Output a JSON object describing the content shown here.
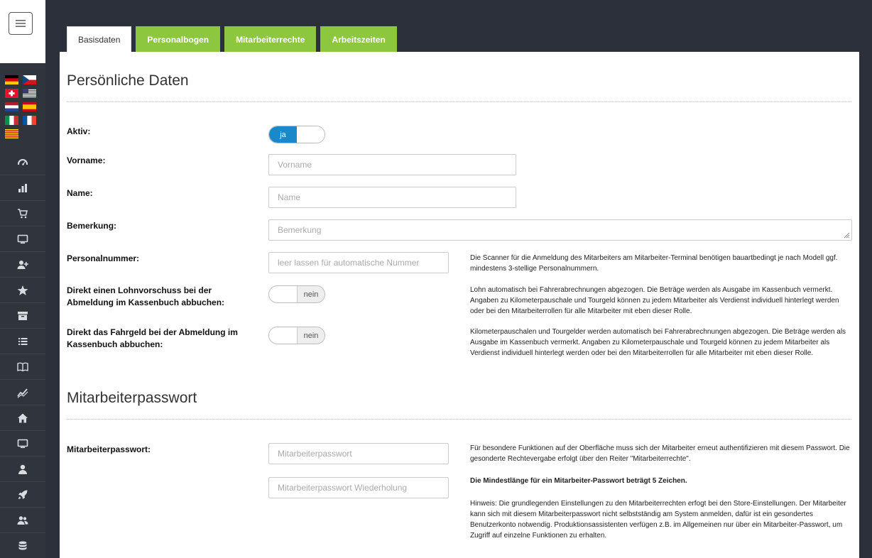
{
  "tabs": [
    {
      "label": "Basisdaten",
      "active": true
    },
    {
      "label": "Personalbogen",
      "active": false
    },
    {
      "label": "Mitarbeiterrechte",
      "active": false
    },
    {
      "label": "Arbeitszeiten",
      "active": false
    }
  ],
  "colors": {
    "accent_green": "#8dc63f",
    "toggle_blue": "#1a88c9",
    "sidebar_bg": "#2f343d"
  },
  "flags": [
    "de",
    "cz",
    "ch",
    "us",
    "nl",
    "es",
    "it",
    "fr",
    "ca"
  ],
  "sidebar_icons": [
    "gauge-icon",
    "bar-chart-icon",
    "cart-icon",
    "monitor-icon",
    "user-add-icon",
    "star-icon",
    "archive-icon",
    "list-icon",
    "book-icon",
    "trend-icon",
    "home-icon",
    "desktop-icon",
    "user-icon",
    "rocket-icon",
    "users-icon",
    "database-icon"
  ],
  "personal": {
    "title": "Persönliche Daten",
    "aktiv_label": "Aktiv:",
    "aktiv_toggle": "ja",
    "vorname_label": "Vorname:",
    "vorname_placeholder": "Vorname",
    "name_label": "Name:",
    "name_placeholder": "Name",
    "bemerkung_label": "Bemerkung:",
    "bemerkung_placeholder": "Bemerkung",
    "personalnummer_label": "Personalnummer:",
    "personalnummer_placeholder": "leer lassen für automatische Nummer",
    "personalnummer_hint": "Die Scanner für die Anmeldung des Mitarbeiters am Mitarbeiter-Terminal benötigen bauartbedingt je nach Modell ggf. mindestens 3-stellige Personalnummern.",
    "lohnvorschuss_label": "Direkt einen Lohnvorschuss bei der Abmeldung im Kassenbuch abbuchen:",
    "lohnvorschuss_toggle": "nein",
    "lohnvorschuss_hint": "Lohn automatisch bei Fahrerabrechnungen abgezogen. Die Beträge werden als Ausgabe im Kassenbuch vermerkt. Angaben zu Kilometerpauschale und Tourgeld können zu jedem Mitarbeiter als Verdienst individuell hinterlegt werden oder bei den Mitarbeiterrollen für alle Mitarbeiter mit eben dieser Rolle.",
    "fahrgeld_label": "Direkt das Fahrgeld bei der Abmeldung im Kassenbuch abbuchen:",
    "fahrgeld_toggle": "nein",
    "fahrgeld_hint": "Kilometerpauschalen und Tourgelder werden automatisch bei Fahrerabrechnungen abgezogen. Die Beträge werden als Ausgabe im Kassenbuch vermerkt. Angaben zu Kilometerpauschale und Tourgeld können zu jedem Mitarbeiter als Verdienst individuell hinterlegt werden oder bei den Mitarbeiterrollen für alle Mitarbeiter mit eben dieser Rolle."
  },
  "password": {
    "title": "Mitarbeiterpasswort",
    "label": "Mitarbeiterpasswort:",
    "placeholder": "Mitarbeiterpasswort",
    "repeat_placeholder": "Mitarbeiterpasswort Wiederholung",
    "hint": "Für besondere Funktionen auf der Oberfläche muss sich der Mitarbeiter erneut authentifizieren mit diesem Passwort. Die gesonderte Rechtevergabe erfolgt über den Reiter \"Mitarbeiterrechte\".",
    "min_length": "Die Mindestlänge für ein Mitarbeiter-Passwort beträgt 5 Zeichen.",
    "note": "Hinweis: Die grundlegenden Einstellungen zu den Mitarbeiterrechten erfogt bei den Store-Einstellungen. Der Mitarbeiter kann sich mit diesem Mitarbeiterpasswort nicht selbstständig am System anmelden, dafür ist ein gesondertes Benutzerkonto notwendig. Produktionsassistenten verfügen z.B. im Allgemeinen nur über ein Mitarbeiter-Passwort, um Zugriff auf einzelne Funktionen zu erhalten."
  }
}
